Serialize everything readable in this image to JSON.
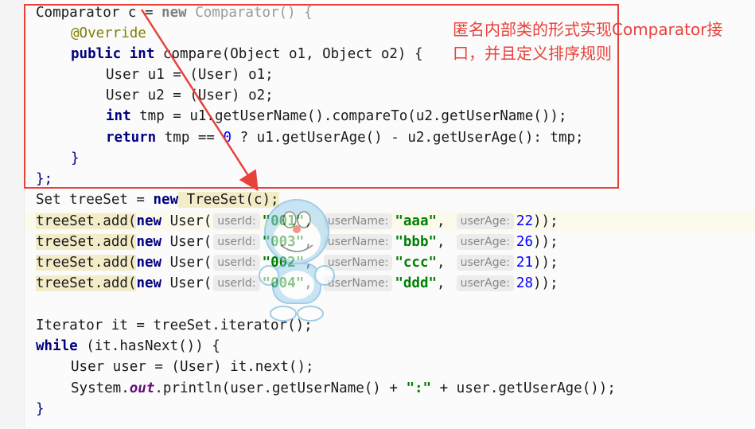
{
  "annotation": {
    "note": "匿名内部类的形式实现Comparator接口，并且定义排序规则"
  },
  "code": {
    "l1": {
      "a": "Comparator c = ",
      "new": "new",
      "b": " Comparator() {"
    },
    "l2": {
      "ann": "@Override"
    },
    "l3": {
      "pub": "public",
      "int": "int",
      "rest": " compare(Object o1, Object o2) {"
    },
    "l4": {
      "text": "User u1 = (User) o1;"
    },
    "l5": {
      "text": "User u2 = (User) o2;"
    },
    "l6": {
      "int": "int",
      "rest": " tmp = u1.getUserName().compareTo(u2.getUserName());"
    },
    "l7": {
      "ret": "return",
      "a": " tmp == ",
      "zero": "0",
      "b": " ? u1.getUserAge() - u2.getUserAge(): tmp;"
    },
    "l8": {
      "text": "}"
    },
    "l9": {
      "text": "};"
    },
    "l10": {
      "a": "Set treeSet = ",
      "new": "new",
      "b": " TreeSet(c);"
    },
    "adds": [
      {
        "id": "\"001\"",
        "name": "\"aaa\"",
        "age": "22"
      },
      {
        "id": "\"003\"",
        "name": "\"bbb\"",
        "age": "26"
      },
      {
        "id": "\"002\"",
        "name": "\"ccc\"",
        "age": "21"
      },
      {
        "id": "\"004\"",
        "name": "\"ddd\"",
        "age": "28"
      }
    ],
    "add_prefix": "treeSet.add(",
    "new_kw": "new",
    "user_open": " User(",
    "hint_id": "userId:",
    "hint_name": "userName:",
    "hint_age": "userAge:",
    "comma": ",",
    "close": "));",
    "l16": {
      "text": "Iterator it = treeSet.iterator();"
    },
    "l17": {
      "kw": "while",
      "rest": " (it.hasNext()) {"
    },
    "l18": {
      "text": "User user = (User) it.next();"
    },
    "l19": {
      "a": "System.",
      "out": "out",
      "b": ".println(user.getUserName() + ",
      "colon": "\":\"",
      "c": " + user.getUserAge());"
    },
    "l20": {
      "text": "}"
    }
  }
}
